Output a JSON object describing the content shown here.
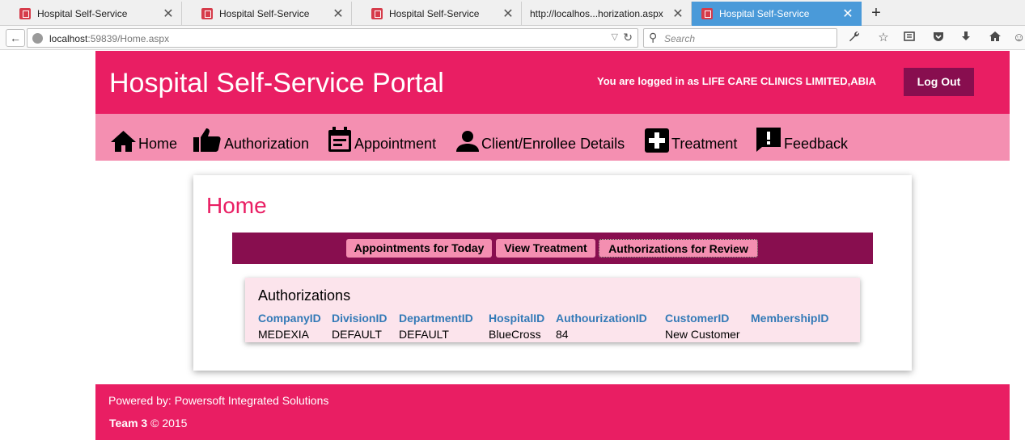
{
  "browser": {
    "tabs": [
      {
        "title": "Hospital Self-Service"
      },
      {
        "title": "Hospital Self-Service"
      },
      {
        "title": "Hospital Self-Service"
      },
      {
        "title": "http://localhos...horization.aspx"
      },
      {
        "title": "Hospital Self-Service"
      }
    ],
    "new_tab": "+",
    "close_glyph": "✕",
    "url_host": "localhost",
    "url_rest": ":59839/Home.aspx",
    "search_placeholder": "Search"
  },
  "header": {
    "title": "Hospital Self-Service Portal",
    "login_text": "You are logged in as LIFE CARE CLINICS LIMITED,ABIA",
    "logout_label": "Log Out"
  },
  "nav": {
    "items": [
      {
        "label": "Home",
        "icon": "home-icon"
      },
      {
        "label": "Authorization",
        "icon": "thumbs-up-icon"
      },
      {
        "label": "Appointment",
        "icon": "calendar-icon"
      },
      {
        "label": "Client/Enrollee Details",
        "icon": "person-icon"
      },
      {
        "label": "Treatment",
        "icon": "medical-cross-icon"
      },
      {
        "label": "Feedback",
        "icon": "feedback-icon"
      }
    ]
  },
  "main": {
    "page_title": "Home",
    "subnav": [
      {
        "label": "Appointments for Today"
      },
      {
        "label": "View Treatment"
      },
      {
        "label": "Authorizations for Review"
      }
    ],
    "authorizations": {
      "heading": "Authorizations",
      "columns": [
        "CompanyID",
        "DivisionID",
        "DepartmentID",
        "HospitalID",
        "AuthourizationID",
        "CustomerID",
        "MembershipID"
      ],
      "rows": [
        [
          "MEDEXIA",
          "DEFAULT",
          "DEFAULT",
          "BlueCross",
          "84",
          "New Customer",
          ""
        ]
      ]
    }
  },
  "footer": {
    "powered_by": "Powered by: Powersoft Integrated Solutions",
    "team": "Team 3",
    "copyright": " © 2015"
  },
  "colors": {
    "primary": "#e91e63",
    "nav_bg": "#f48fb1",
    "dark": "#880e4f",
    "panel_bg": "#fce4ec",
    "link": "#337ab7"
  }
}
